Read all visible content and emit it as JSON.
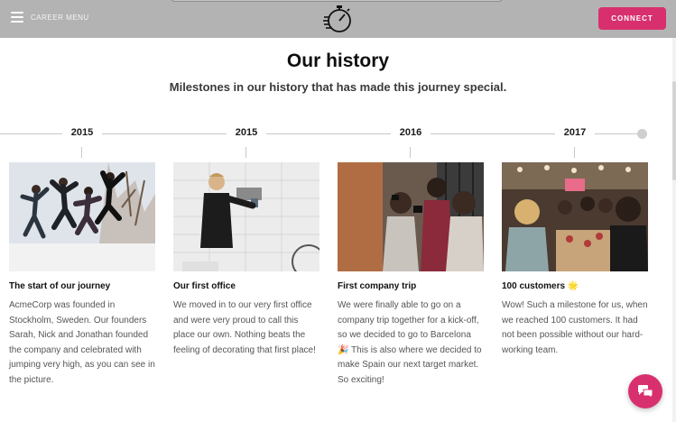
{
  "header": {
    "menu_label": "CAREER MENU",
    "connect_label": "CONNECT",
    "logo_icon": "stopwatch-icon",
    "accent_color": "#d8306f"
  },
  "main": {
    "title": "Our history",
    "subtitle": "Milestones in our history that has made this journey special."
  },
  "timeline": {
    "years": [
      "2015",
      "2015",
      "2016",
      "2017"
    ]
  },
  "cards": [
    {
      "title": "The start of our journey",
      "text": "AcmeCorp was founded in Stockholm, Sweden. Our founders Sarah, Nick and Jonathan founded the company and celebrated with jumping very high, as you can see in the picture."
    },
    {
      "title": "Our first office",
      "text": "We moved in to our very first office and were very proud to call this place our own. Nothing beats the feeling of decorating that first place!"
    },
    {
      "title": "First company trip",
      "text": "We were finally able to go on a company trip together for a kick-off, so we decided to go to Barcelona 🎉 This is also where we decided to make Spain our next target market. So exciting!"
    },
    {
      "title": "100 customers 🌟",
      "text": "Wow! Such a milestone for us, when we reached 100 customers. It had not been possible without our hard-working team."
    }
  ],
  "chat": {
    "icon": "chat-bubbles-icon"
  }
}
